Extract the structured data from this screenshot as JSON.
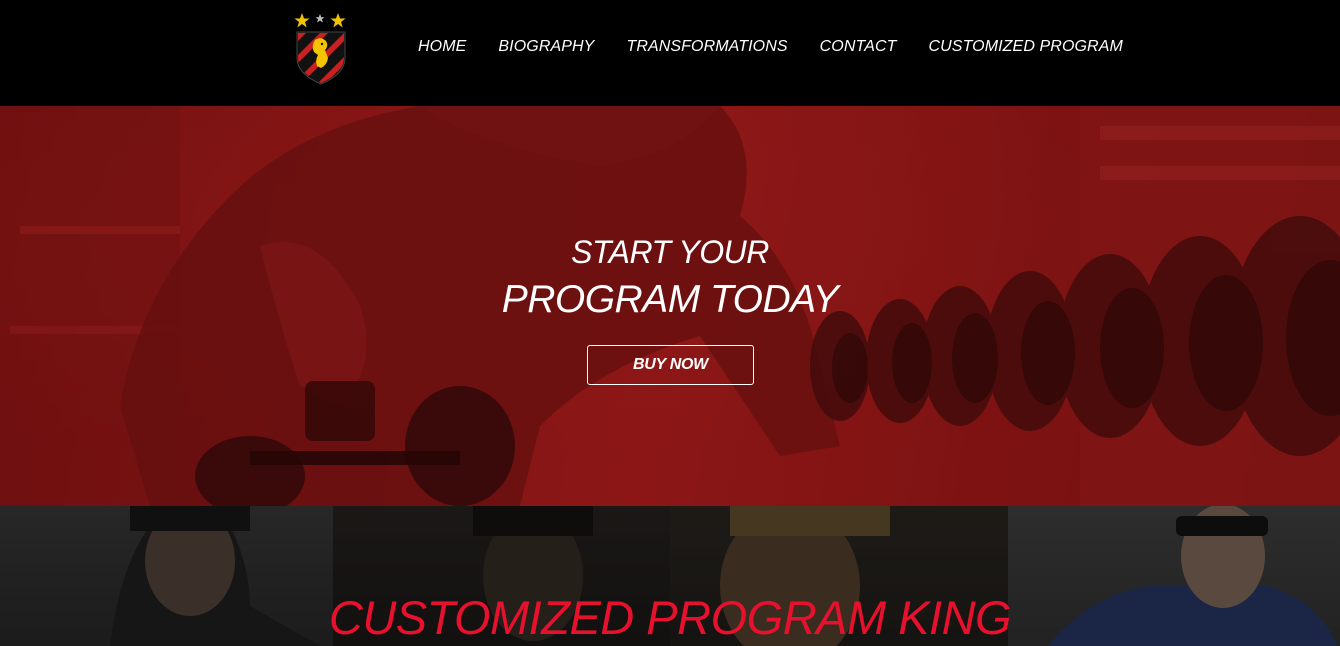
{
  "nav": {
    "items": [
      {
        "label": "HOME"
      },
      {
        "label": "BIOGRAPHY"
      },
      {
        "label": "TRANSFORMATIONS"
      },
      {
        "label": "CONTACT"
      },
      {
        "label": "CUSTOMIZED PROGRAM"
      }
    ]
  },
  "hero": {
    "line1": "START YOUR",
    "line2": "PROGRAM TODAY",
    "button_label": "BUY NOW"
  },
  "gallery": {
    "title": "CUSTOMIZED PROGRAM KING"
  },
  "colors": {
    "header_bg": "#000000",
    "hero_red": "#8e1b1b",
    "title_red": "#e8112d",
    "logo_red": "#cc1f1f",
    "logo_gold": "#f5c400"
  }
}
